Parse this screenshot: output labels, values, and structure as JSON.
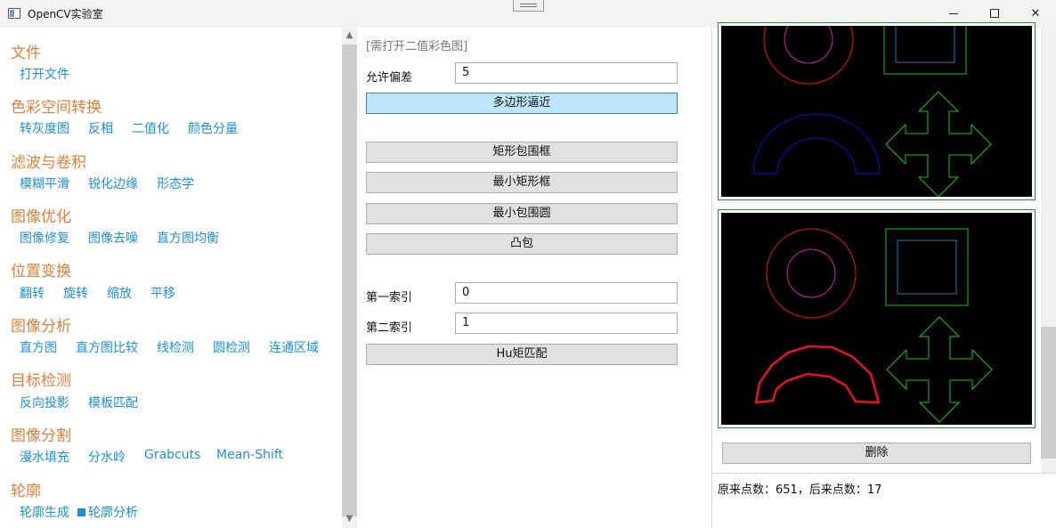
{
  "window": {
    "title": "OpenCV实验室",
    "min_glyph": "",
    "max_glyph": "",
    "close_glyph": "✕"
  },
  "sidebar": {
    "categories": [
      {
        "title": "文件",
        "items": [
          "打开文件"
        ]
      },
      {
        "title": "色彩空间转换",
        "items": [
          "转灰度图",
          "反相",
          "二值化",
          "颜色分量"
        ]
      },
      {
        "title": "滤波与卷积",
        "items": [
          "模糊平滑",
          "锐化边缘",
          "形态学"
        ]
      },
      {
        "title": "图像优化",
        "items": [
          "图像修复",
          "图像去噪",
          "直方图均衡"
        ]
      },
      {
        "title": "位置变换",
        "items": [
          "翻转",
          "旋转",
          "缩放",
          "平移"
        ]
      },
      {
        "title": "图像分析",
        "items": [
          "直方图",
          "直方图比较",
          "线检测",
          "圆检测",
          "连通区域"
        ]
      },
      {
        "title": "目标检测",
        "items": [
          "反向投影",
          "模板匹配"
        ]
      },
      {
        "title": "图像分割",
        "items": [
          "漫水填充",
          "分水岭",
          "Grabcuts",
          "Mean-Shift"
        ]
      },
      {
        "title": "轮廓",
        "items": [
          "轮廓生成",
          "轮廓分析"
        ]
      }
    ],
    "active_item": "轮廓分析",
    "scroll_up": "▲",
    "scroll_down": "▼"
  },
  "panel": {
    "hint": "[需打开二值彩色图]",
    "tolerance_label": "允许偏差",
    "tolerance_value": "5",
    "polygon_button": "多边形逼近",
    "bounding_rect_button": "矩形包围框",
    "min_rect_button": "最小矩形框",
    "min_circle_button": "最小包围圆",
    "convex_hull_button": "凸包",
    "first_index_label": "第一索引",
    "first_index_value": "0",
    "second_index_label": "第二索引",
    "second_index_value": "1",
    "hu_match_button": "Hu矩匹配"
  },
  "result": {
    "delete_button": "删除",
    "status_text": "原来点数：651，后来点数：17"
  },
  "colors": {
    "category": "#e0803a",
    "link": "#1e8fd5",
    "highlight_button": "#bee6fd",
    "image_border": "#2b8a3e",
    "contour_red": "#e8102a",
    "contour_green": "#16c416",
    "contour_blue": "#1010d0",
    "contour_magenta": "#d020b0",
    "contour_cyan": "#2080b0"
  }
}
